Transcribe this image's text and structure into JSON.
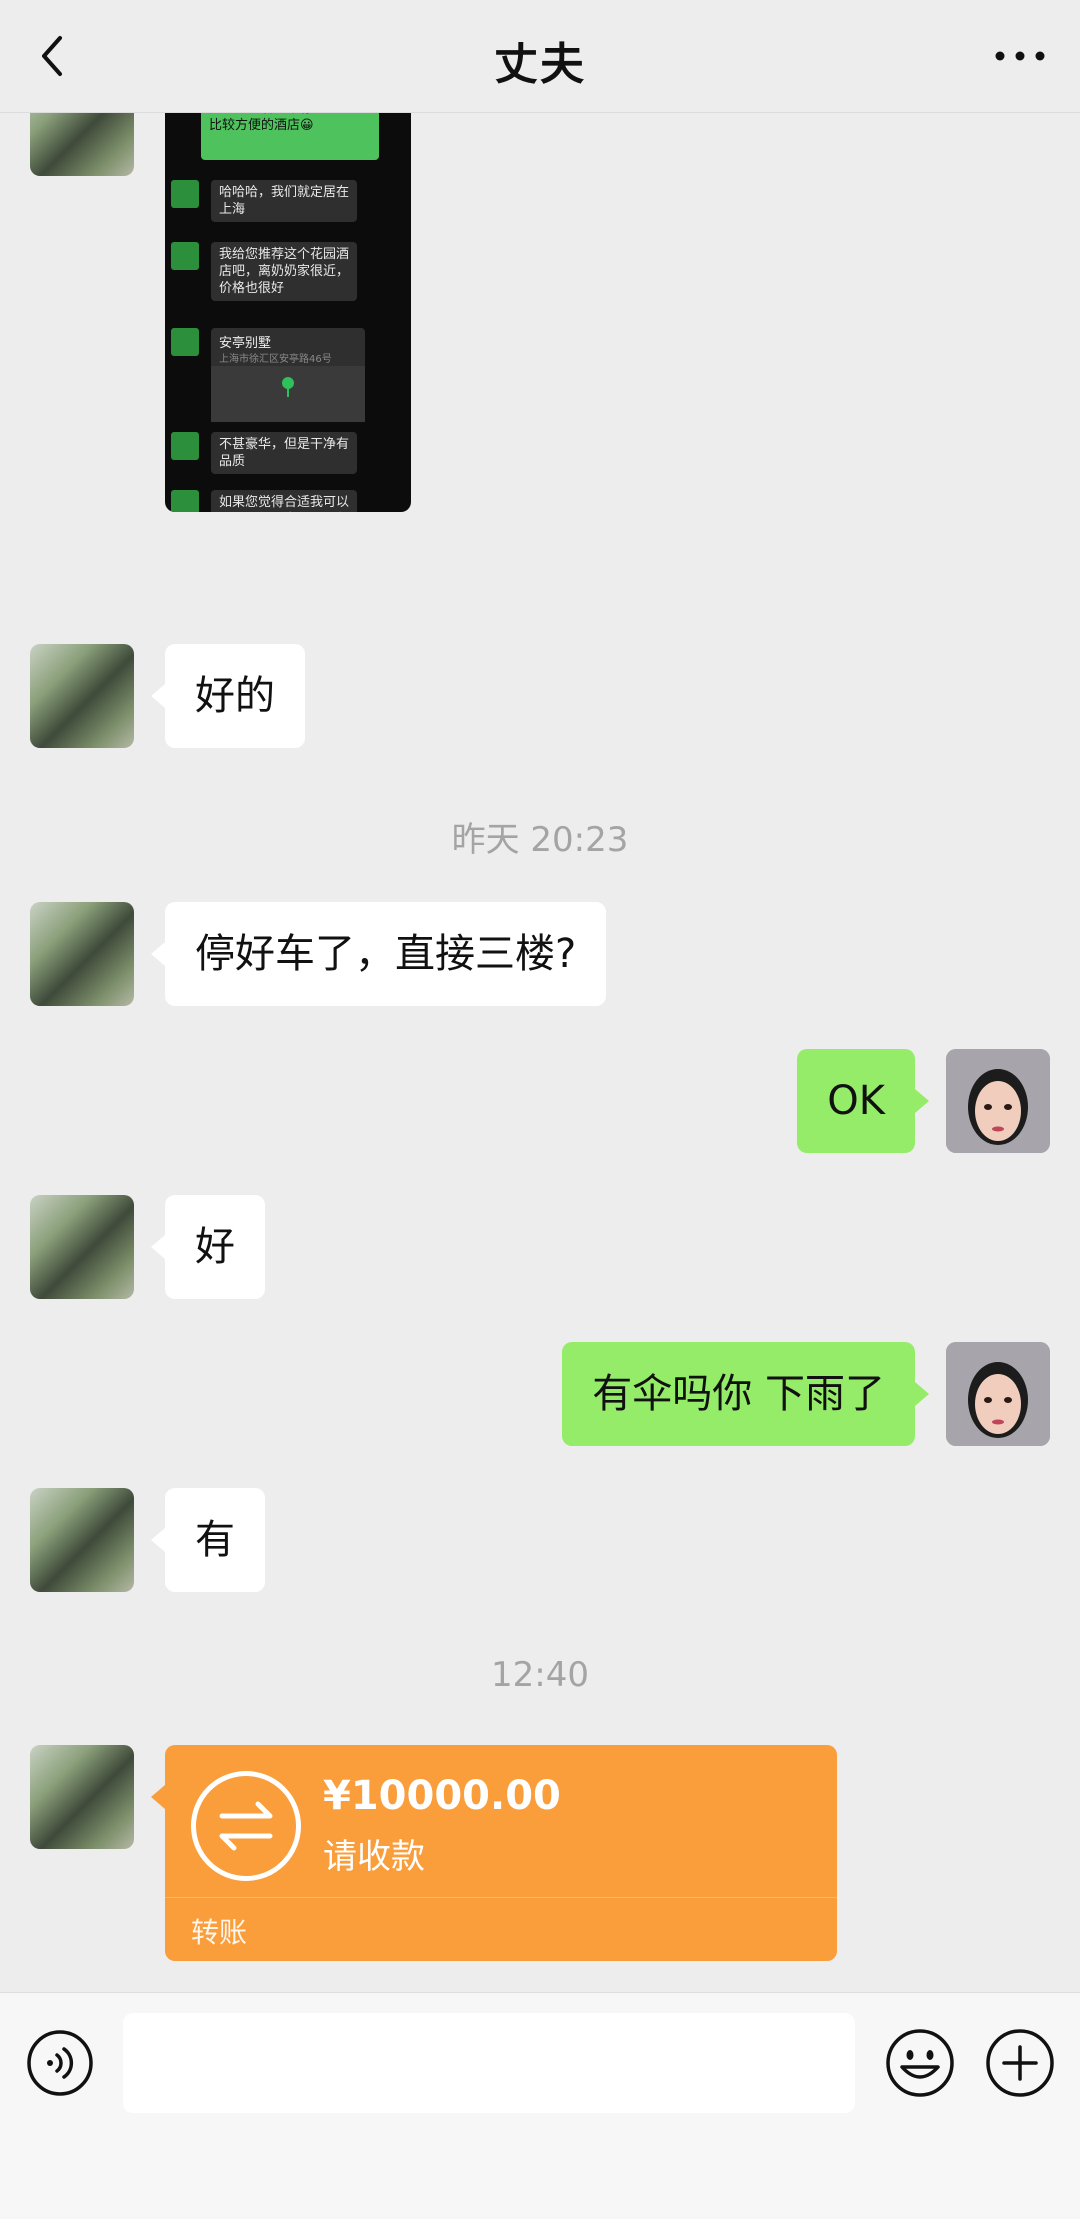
{
  "header": {
    "title": "丈夫"
  },
  "shared_image": {
    "green_bubble_text": "店呢？或者请推荐一个\n比较方便的酒店😀",
    "rows": [
      {
        "text": "哈哈哈，我们就定居在\n上海"
      },
      {
        "text": "我给您推荐这个花园酒\n店吧，离奶奶家很近，\n价格也很好"
      },
      {
        "location_title": "安亭别墅",
        "location_address": "上海市徐汇区安亭路46号"
      },
      {
        "text": "不甚豪华，但是干净有\n品质"
      },
      {
        "text": "如果您觉得合适我可以\n跟那边经理交代一下帮\n忙预定"
      }
    ]
  },
  "messages": [
    {
      "side": "in",
      "text": "好的"
    },
    {
      "time": "昨天 20:23"
    },
    {
      "side": "in",
      "text": "停好车了，直接三楼?"
    },
    {
      "side": "out",
      "text": "OK"
    },
    {
      "side": "in",
      "text": "好"
    },
    {
      "side": "out",
      "text": "有伞吗你 下雨了"
    },
    {
      "side": "in",
      "text": "有"
    },
    {
      "time": "12:40"
    }
  ],
  "transfer": {
    "amount": "¥10000.00",
    "status": "请收款",
    "label": "转账"
  },
  "footer": {
    "input_placeholder": ""
  }
}
